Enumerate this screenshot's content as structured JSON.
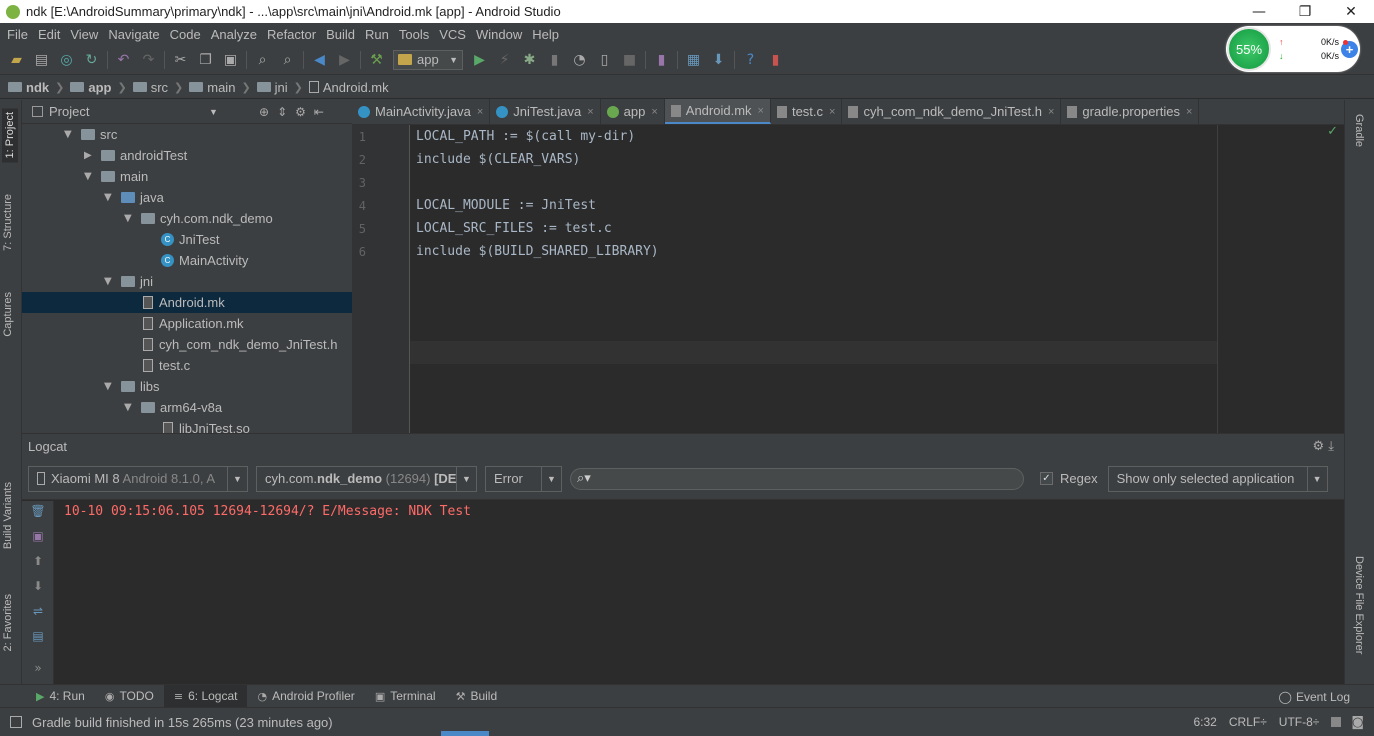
{
  "window": {
    "title": "ndk [E:\\AndroidSummary\\primary\\ndk] - ...\\app\\src\\main\\jni\\Android.mk [app] - Android Studio",
    "minimize": "—",
    "restore": "❐",
    "close": "✕"
  },
  "menu": [
    "File",
    "Edit",
    "View",
    "Navigate",
    "Code",
    "Analyze",
    "Refactor",
    "Build",
    "Run",
    "Tools",
    "VCS",
    "Window",
    "Help"
  ],
  "toolbar": {
    "run_config": "app"
  },
  "net_widget": {
    "percent": "55%",
    "up_rate": "0K/s",
    "down_rate": "0K/s",
    "up_arrow": "↑",
    "down_arrow": "↓",
    "plus": "+"
  },
  "breadcrumb": [
    "ndk",
    "app",
    "src",
    "main",
    "jni",
    "Android.mk"
  ],
  "left_strip": {
    "project": "1: Project",
    "structure": "7: Structure",
    "captures": "Captures",
    "build_variants": "Build Variants",
    "favorites": "2: Favorites"
  },
  "right_strip": {
    "gradle": "Gradle",
    "device_file_explorer": "Device File Explorer"
  },
  "project_panel": {
    "title": "Project",
    "tree": [
      {
        "label": "src",
        "depth": 0,
        "expanded": true,
        "kind": "folder"
      },
      {
        "label": "androidTest",
        "depth": 1,
        "expanded": false,
        "kind": "folder"
      },
      {
        "label": "main",
        "depth": 1,
        "expanded": true,
        "kind": "folder"
      },
      {
        "label": "java",
        "depth": 2,
        "expanded": true,
        "kind": "folder-blue"
      },
      {
        "label": "cyh.com.ndk_demo",
        "depth": 3,
        "expanded": true,
        "kind": "folder"
      },
      {
        "label": "JniTest",
        "depth": 4,
        "kind": "class"
      },
      {
        "label": "MainActivity",
        "depth": 4,
        "kind": "class"
      },
      {
        "label": "jni",
        "depth": 2,
        "expanded": true,
        "kind": "folder"
      },
      {
        "label": "Android.mk",
        "depth": 3,
        "kind": "file",
        "selected": true
      },
      {
        "label": "Application.mk",
        "depth": 3,
        "kind": "file"
      },
      {
        "label": "cyh_com_ndk_demo_JniTest.h",
        "depth": 3,
        "kind": "file"
      },
      {
        "label": "test.c",
        "depth": 3,
        "kind": "file"
      },
      {
        "label": "libs",
        "depth": 2,
        "expanded": true,
        "kind": "folder"
      },
      {
        "label": "arm64-v8a",
        "depth": 3,
        "expanded": true,
        "kind": "folder"
      },
      {
        "label": "libJniTest.so",
        "depth": 4,
        "kind": "file"
      }
    ]
  },
  "editor": {
    "tabs": [
      {
        "label": "MainActivity.java",
        "icon": "class"
      },
      {
        "label": "JniTest.java",
        "icon": "class"
      },
      {
        "label": "app",
        "icon": "gradle"
      },
      {
        "label": "Android.mk",
        "icon": "file",
        "active": true
      },
      {
        "label": "test.c",
        "icon": "file"
      },
      {
        "label": "cyh_com_ndk_demo_JniTest.h",
        "icon": "file"
      },
      {
        "label": "gradle.properties",
        "icon": "file"
      }
    ],
    "close_glyph": "×",
    "lines": [
      "LOCAL_PATH := $(call my-dir)",
      "include $(CLEAR_VARS)",
      "",
      "LOCAL_MODULE := JniTest",
      "LOCAL_SRC_FILES := test.c",
      "include $(BUILD_SHARED_LIBRARY)"
    ],
    "line_numbers": [
      "1",
      "2",
      "3",
      "4",
      "5",
      "6"
    ]
  },
  "logcat": {
    "title": "Logcat",
    "device_name": "Xiaomi MI 8",
    "device_detail": "Android 8.1.0, A",
    "process_pkg_pre": "cyh.com.",
    "process_pkg_bold": "ndk_demo",
    "process_pid": "(12694)",
    "process_tag": "[DE",
    "level": "Error",
    "regex_label": "Regex",
    "regex_checked": true,
    "filter": "Show only selected application",
    "lines": [
      "10-10 09:15:06.105 12694-12694/? E/Message: NDK Test"
    ]
  },
  "bottom_tabs": [
    {
      "label": "4: Run",
      "icon": "▶"
    },
    {
      "label": "TODO",
      "icon": "◉"
    },
    {
      "label": "6: Logcat",
      "icon": "≡",
      "active": true
    },
    {
      "label": "Android Profiler",
      "icon": "◔"
    },
    {
      "label": "Terminal",
      "icon": "▣"
    },
    {
      "label": "Build",
      "icon": "⚒"
    }
  ],
  "event_log": "Event Log",
  "status": {
    "message": "Gradle build finished in 15s 265ms (23 minutes ago)",
    "position": "6:32",
    "line_sep": "CRLF÷",
    "encoding": "UTF-8÷"
  },
  "colors": {
    "accent": "#4a88c7",
    "selection": "#0d293e",
    "error": "#ff6b68"
  }
}
